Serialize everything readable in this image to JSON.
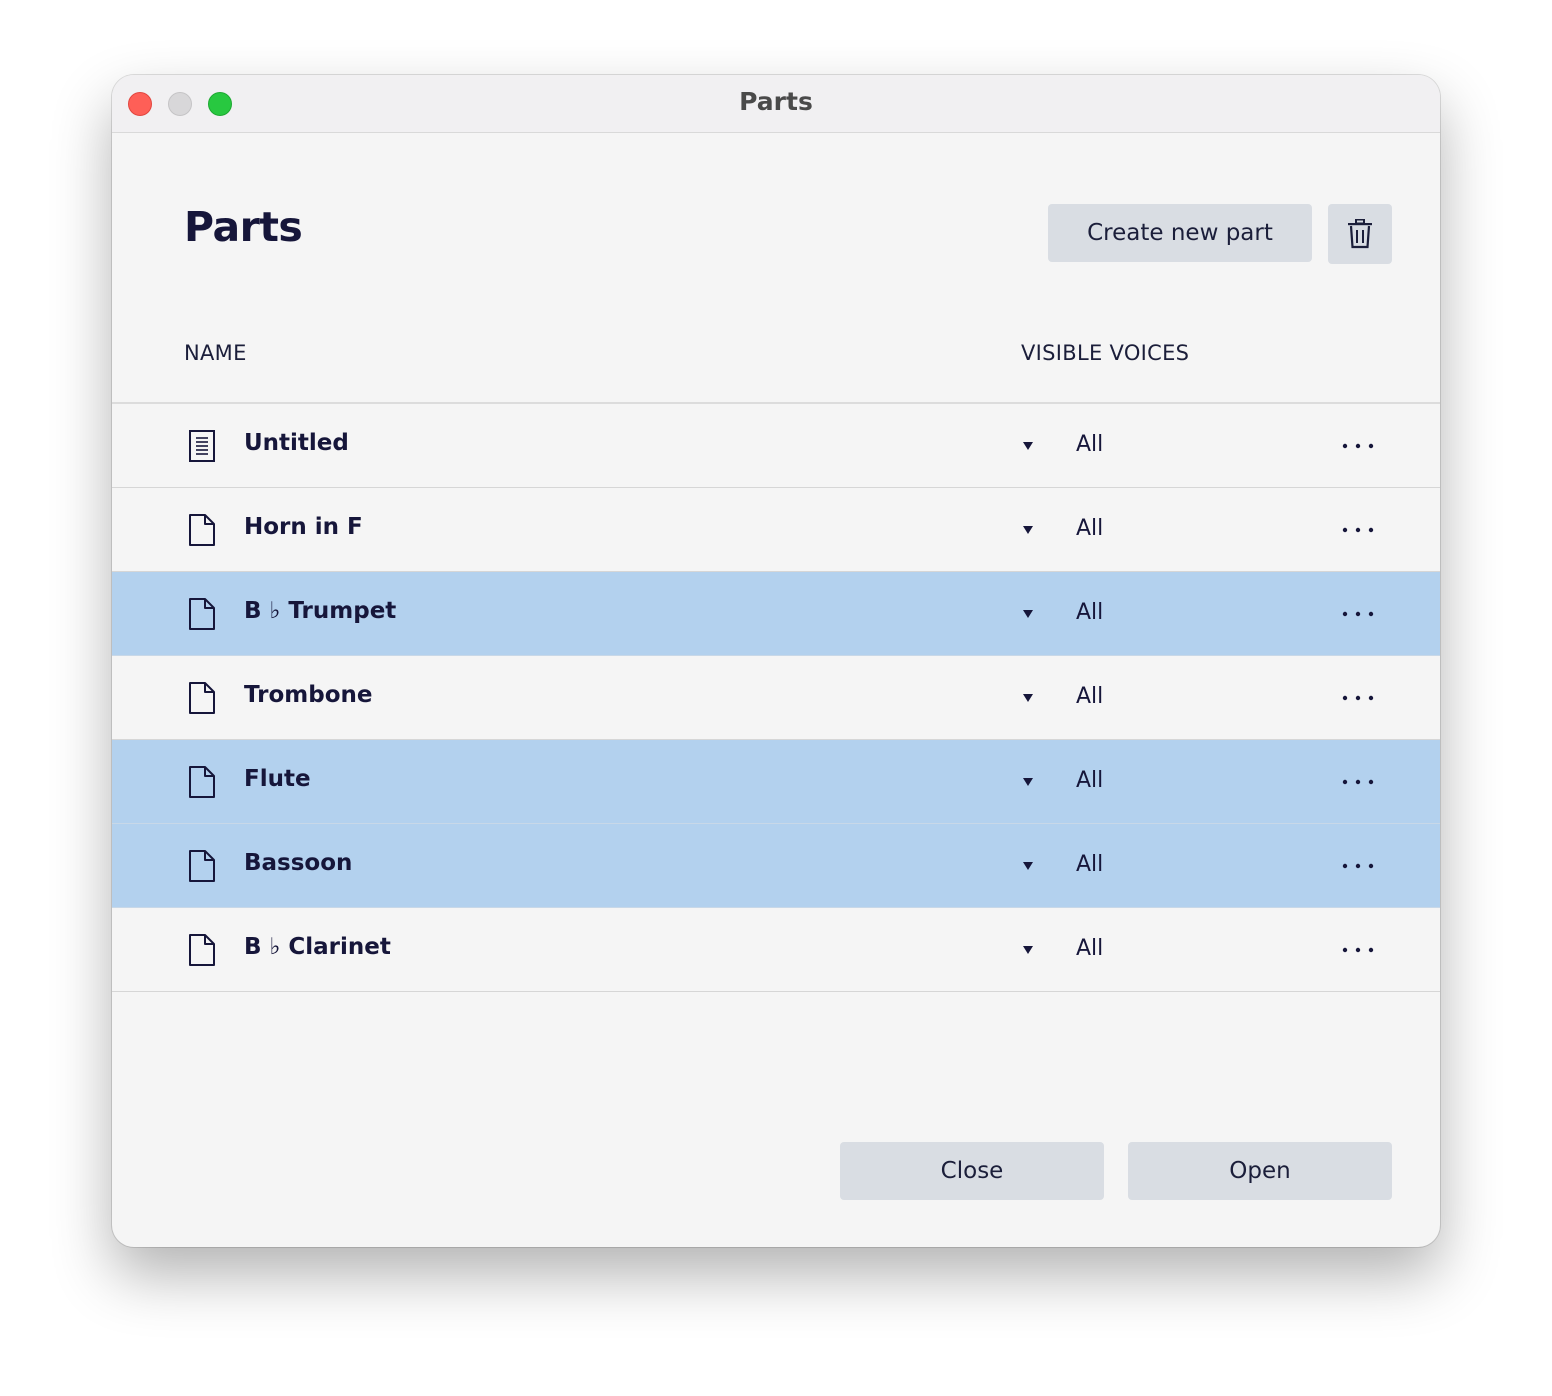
{
  "window": {
    "title": "Parts"
  },
  "header": {
    "title": "Parts",
    "create_label": "Create new part",
    "delete_icon": "trash-icon"
  },
  "columns": {
    "name": "NAME",
    "voices": "VISIBLE VOICES"
  },
  "rows": [
    {
      "name": "Untitled",
      "voices": "All",
      "icon": "score-document-icon",
      "selected": false
    },
    {
      "name": "Horn in F",
      "voices": "All",
      "icon": "document-icon",
      "selected": false
    },
    {
      "name": "B ♭ Trumpet",
      "voices": "All",
      "icon": "document-icon",
      "selected": true
    },
    {
      "name": "Trombone",
      "voices": "All",
      "icon": "document-icon",
      "selected": false
    },
    {
      "name": "Flute",
      "voices": "All",
      "icon": "document-icon",
      "selected": true
    },
    {
      "name": "Bassoon",
      "voices": "All",
      "icon": "document-icon",
      "selected": true
    },
    {
      "name": "B ♭ Clarinet",
      "voices": "All",
      "icon": "document-icon",
      "selected": false
    }
  ],
  "footer": {
    "close_label": "Close",
    "open_label": "Open"
  },
  "colors": {
    "selection": "#b3d1ee",
    "button": "#d9dde3",
    "text": "#16163a"
  }
}
